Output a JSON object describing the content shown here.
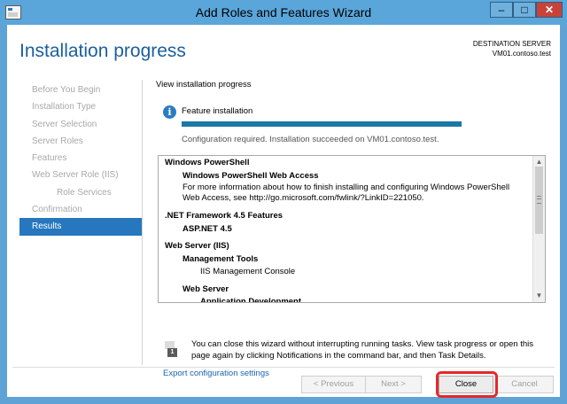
{
  "window": {
    "title": "Add Roles and Features Wizard",
    "controls": {
      "minimize": "–",
      "maximize": "□",
      "close": "✕"
    }
  },
  "header": {
    "page_title": "Installation progress",
    "destination_label": "DESTINATION SERVER",
    "destination_server": "VM01.contoso.test"
  },
  "nav": {
    "items": [
      {
        "label": "Before You Begin",
        "state": "disabled"
      },
      {
        "label": "Installation Type",
        "state": "disabled"
      },
      {
        "label": "Server Selection",
        "state": "disabled"
      },
      {
        "label": "Server Roles",
        "state": "disabled"
      },
      {
        "label": "Features",
        "state": "disabled"
      },
      {
        "label": "Web Server Role (IIS)",
        "state": "disabled"
      },
      {
        "label": "Role Services",
        "state": "disabled"
      },
      {
        "label": "Confirmation",
        "state": "disabled"
      },
      {
        "label": "Results",
        "state": "active"
      }
    ]
  },
  "main": {
    "heading": "View installation progress",
    "status_icon": "info-icon",
    "feature_label": "Feature installation",
    "progress_percent": 100,
    "result_text": "Configuration required. Installation succeeded on VM01.contoso.test.",
    "details": {
      "windows_powershell": "Windows PowerShell",
      "pswa": "Windows PowerShell Web Access",
      "pswa_desc": "For more information about how to finish installing and configuring Windows PowerShell Web Access, see http://go.microsoft.com/fwlink/?LinkID=221050.",
      "net_framework": ".NET Framework 4.5 Features",
      "aspnet": "ASP.NET 4.5",
      "web_server": "Web Server (IIS)",
      "mgmt_tools": "Management Tools",
      "iis_console": "IIS Management Console",
      "web_server_sub": "Web Server",
      "app_dev": "Application Development"
    },
    "note_icon": "notification-flag-icon",
    "note_badge": "1",
    "note_text": "You can close this wizard without interrupting running tasks. View task progress or open this page again by clicking Notifications in the command bar, and then Task Details.",
    "export_link": "Export configuration settings"
  },
  "footer": {
    "previous": "< Previous",
    "next": "Next >",
    "close": "Close",
    "cancel": "Cancel"
  },
  "colors": {
    "accent": "#2677bd",
    "title_blue": "#1b5f9e",
    "highlight_red": "#e32a2a",
    "progress": "#1a78a6"
  }
}
